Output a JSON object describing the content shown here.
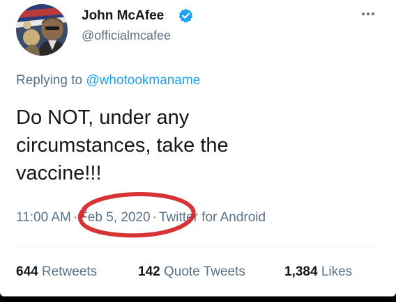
{
  "tweet": {
    "author": {
      "display_name": "John McAfee",
      "handle": "@officialmcafee",
      "verified_icon": "verified-badge-icon",
      "avatar_icon": "profile-photo-avatar"
    },
    "menu_icon": "more-options-icon",
    "replying": {
      "prefix": "Replying to",
      "mention": "@whotookmaname"
    },
    "text_lines": [
      "Do NOT, under any",
      "circumstances, take the",
      "vaccine!!!"
    ],
    "meta": {
      "time": "11:00 AM",
      "separator": "·",
      "date": "Feb 5, 2020",
      "source": "Twitter for Android"
    },
    "stats": {
      "retweets": {
        "count": "644",
        "label": "Retweets"
      },
      "quote_tweets": {
        "count": "142",
        "label": "Quote Tweets"
      },
      "likes": {
        "count": "1,384",
        "label": "Likes"
      }
    }
  },
  "colors": {
    "text_primary": "#14171a",
    "text_secondary": "#5b7083",
    "accent_blue": "#1da1f2",
    "annotation_red": "#d42424",
    "divider": "#e6ecf0",
    "frame": "#000000"
  }
}
